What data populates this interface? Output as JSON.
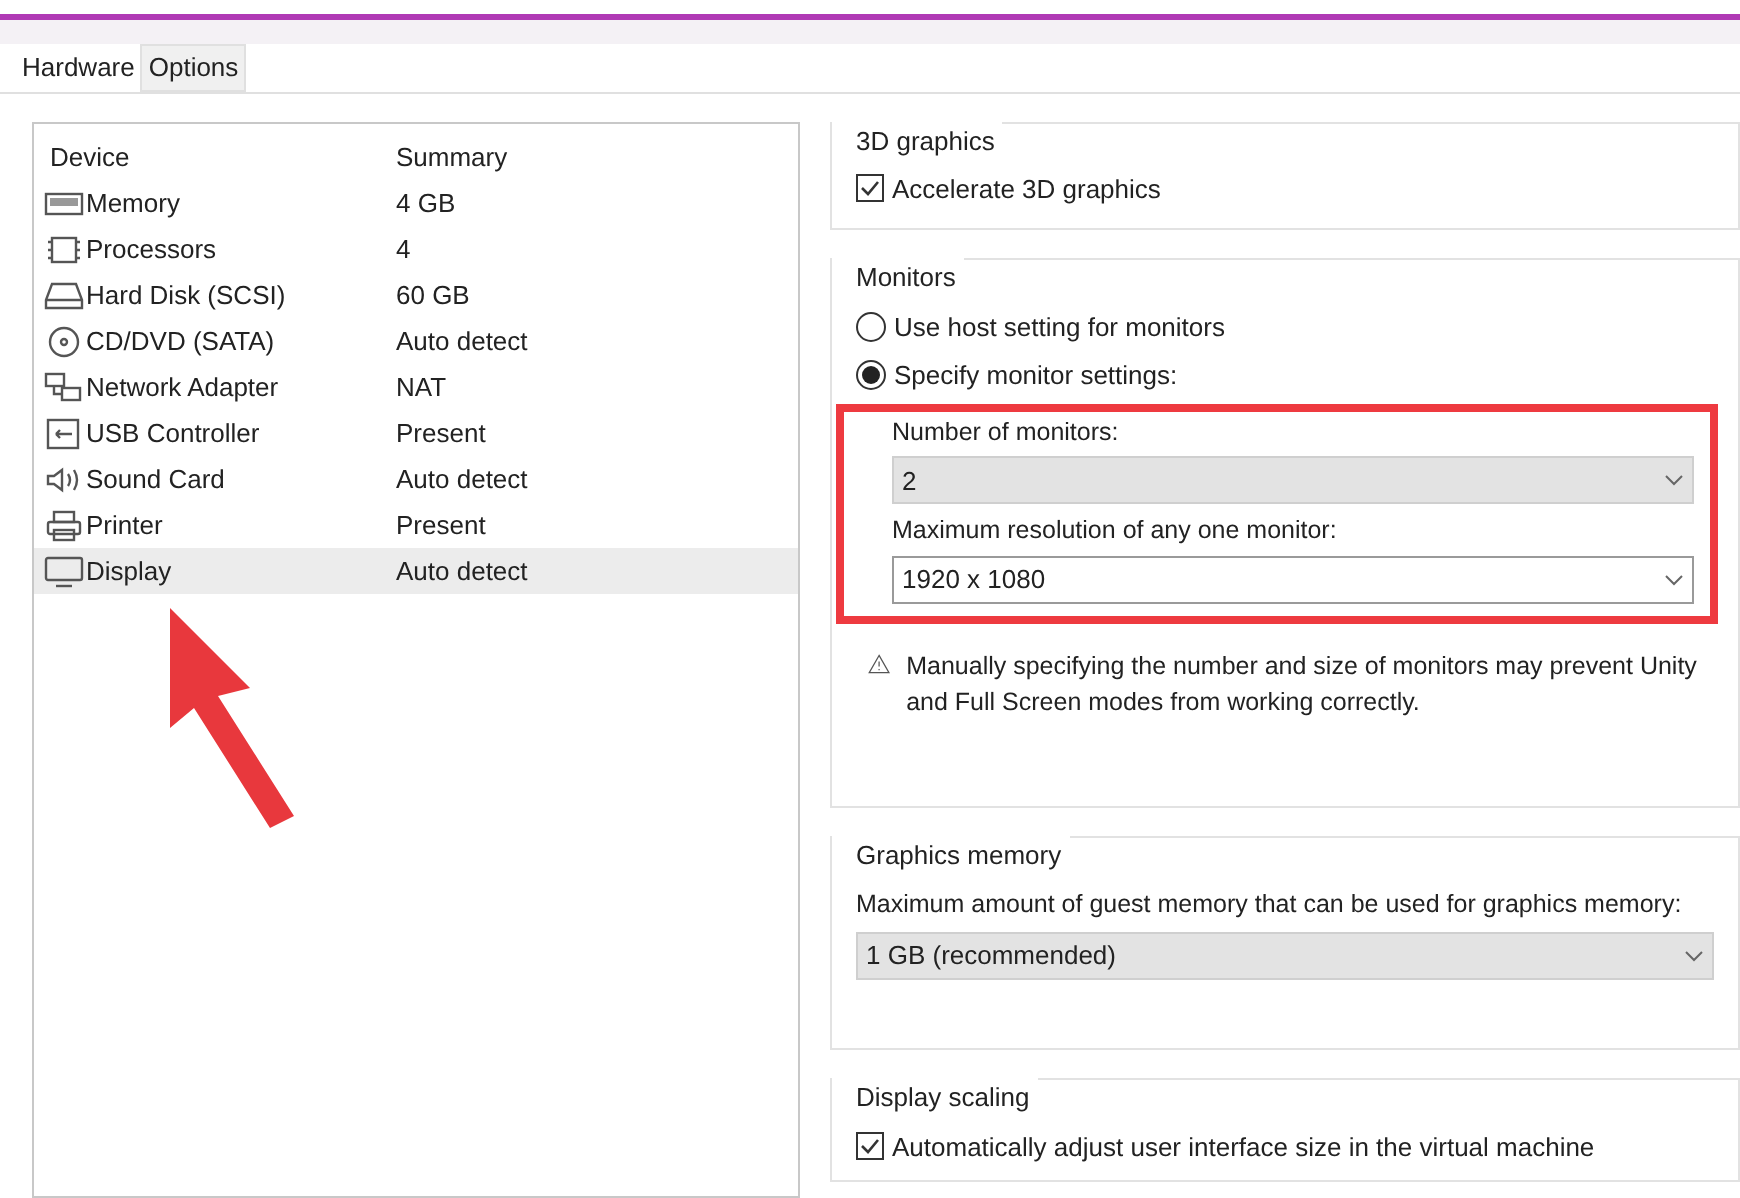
{
  "tabs": [
    {
      "label": "Hardware",
      "selected": true
    },
    {
      "label": "Options",
      "selected": false
    }
  ],
  "devices": {
    "columns": [
      "Device",
      "Summary"
    ],
    "rows": [
      {
        "kind": "memory",
        "name": "Memory",
        "summary": "4 GB",
        "selected": false
      },
      {
        "kind": "processor",
        "name": "Processors",
        "summary": "4",
        "selected": false
      },
      {
        "kind": "disk",
        "name": "Hard Disk (SCSI)",
        "summary": "60 GB",
        "selected": false
      },
      {
        "kind": "cd",
        "name": "CD/DVD (SATA)",
        "summary": "Auto detect",
        "selected": false
      },
      {
        "kind": "network",
        "name": "Network Adapter",
        "summary": "NAT",
        "selected": false
      },
      {
        "kind": "usb",
        "name": "USB Controller",
        "summary": "Present",
        "selected": false
      },
      {
        "kind": "sound",
        "name": "Sound Card",
        "summary": "Auto detect",
        "selected": false
      },
      {
        "kind": "printer",
        "name": "Printer",
        "summary": "Present",
        "selected": false
      },
      {
        "kind": "display",
        "name": "Display",
        "summary": "Auto detect",
        "selected": true
      }
    ]
  },
  "graphics_3d": {
    "title": "3D graphics",
    "accelerate": {
      "label": "Accelerate 3D graphics",
      "checked": true
    }
  },
  "monitors": {
    "title": "Monitors",
    "options": [
      {
        "label": "Use host setting for monitors",
        "selected": false
      },
      {
        "label": "Specify monitor settings:",
        "selected": true
      }
    ],
    "fields": [
      {
        "label": "Number of monitors:",
        "value": "2",
        "disabled": true
      },
      {
        "label": "Maximum resolution of any one monitor:",
        "value": "1920 x 1080",
        "disabled": false
      }
    ],
    "warning": "Manually specifying the number and size of monitors may prevent Unity and Full Screen modes from working correctly."
  },
  "graphics_memory": {
    "title": "Graphics memory",
    "description": "Maximum amount of guest memory that can be used for graphics memory:",
    "value": "1 GB (recommended)",
    "disabled": true
  },
  "display_scaling": {
    "title": "Display scaling",
    "auto_adjust": {
      "label": "Automatically adjust user interface size in the virtual machine",
      "checked": true
    }
  }
}
